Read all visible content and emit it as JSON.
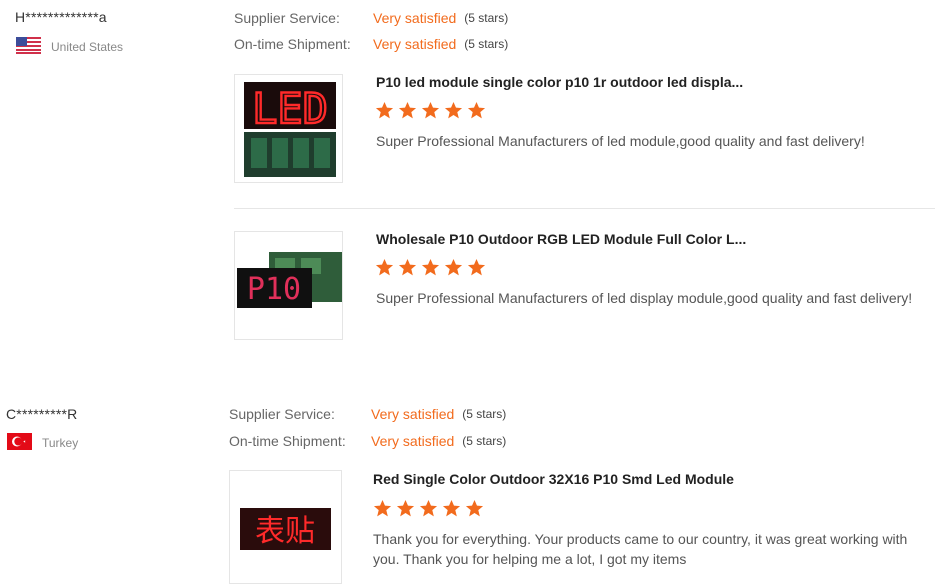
{
  "reviews": [
    {
      "user": "H*************a",
      "country": "United States",
      "supplier_service_label": "Supplier Service:",
      "supplier_service_value": "Very satisfied",
      "supplier_service_stars": "(5 stars)",
      "shipment_label": "On-time Shipment:",
      "shipment_value": "Very satisfied",
      "shipment_stars": "(5 stars)",
      "products": [
        {
          "title": "P10 led module single color p10 1r outdoor led displa...",
          "rating": 5,
          "comment": "Super Professional Manufacturers of led module,good quality and fast delivery!",
          "thumb_text": "LED"
        },
        {
          "title": "Wholesale P10 Outdoor RGB LED Module Full Color L...",
          "rating": 5,
          "comment": "Super Professional Manufacturers of led display module,good quality and fast delivery!",
          "thumb_text": "P10"
        }
      ]
    },
    {
      "user": "C*********R",
      "country": "Turkey",
      "supplier_service_label": "Supplier Service:",
      "supplier_service_value": "Very satisfied",
      "supplier_service_stars": "(5 stars)",
      "shipment_label": "On-time Shipment:",
      "shipment_value": "Very satisfied",
      "shipment_stars": "(5 stars)",
      "products": [
        {
          "title": "Red Single Color Outdoor 32X16 P10 Smd Led Module",
          "rating": 5,
          "comment": "Thank you for everything. Your products came to our country, it was great working with you. Thank you for helping me a lot, I got my items",
          "thumb_text": "表贴"
        }
      ]
    }
  ],
  "colors": {
    "accent": "#f26b1d",
    "label": "#666666"
  },
  "icons": {
    "star": "star-icon",
    "flag_us": "us-flag-icon",
    "flag_tr": "turkey-flag-icon"
  }
}
